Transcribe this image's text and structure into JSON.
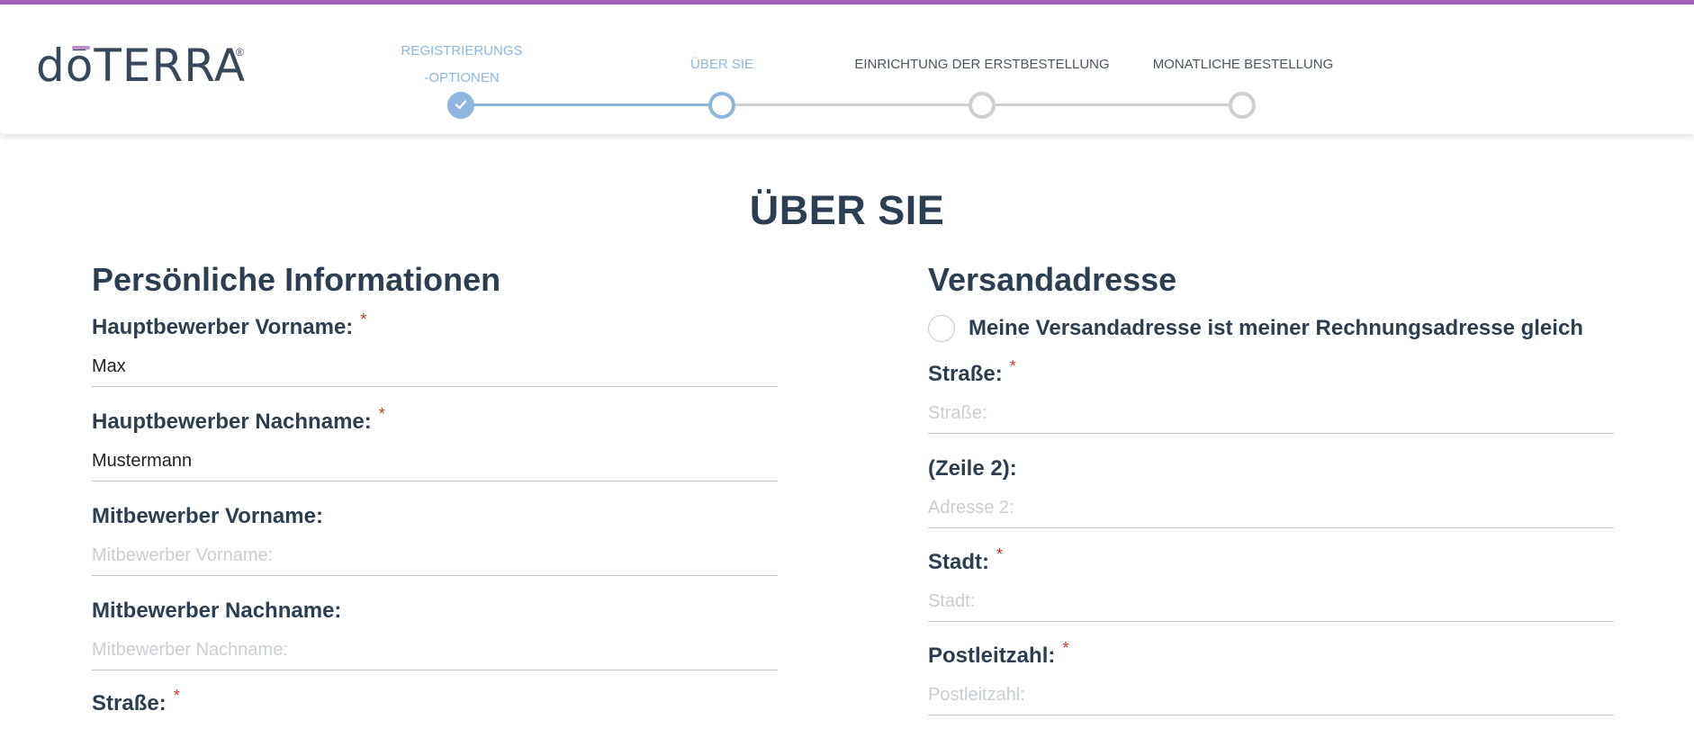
{
  "brand": {
    "logo_text": "dōTERRA",
    "registered": "®"
  },
  "steps": [
    {
      "line1": "REGISTRIERUNGS",
      "line2": "-OPTIONEN",
      "state": "done"
    },
    {
      "line1": "ÜBER SIE",
      "line2": "",
      "state": "current"
    },
    {
      "line1": "EINRICHTUNG DER ERSTBESTELLUNG",
      "line2": "",
      "state": "pending"
    },
    {
      "line1": "MONATLICHE BESTELLUNG",
      "line2": "",
      "state": "pending"
    }
  ],
  "page_title": "ÜBER SIE",
  "personal": {
    "title": "Persönliche Informationen",
    "fields": [
      {
        "label": "Hauptbewerber Vorname:",
        "required": "*",
        "value": "Max",
        "placeholder": ""
      },
      {
        "label": "Hauptbewerber Nachname:",
        "required": "*",
        "value": "Mustermann",
        "placeholder": ""
      },
      {
        "label": "Mitbewerber Vorname:",
        "required": "",
        "value": "",
        "placeholder": "Mitbewerber Vorname:"
      },
      {
        "label": "Mitbewerber Nachname:",
        "required": "",
        "value": "",
        "placeholder": "Mitbewerber Nachname:"
      },
      {
        "label": "Straße:",
        "required": "*",
        "value": "",
        "placeholder": ""
      }
    ]
  },
  "shipping": {
    "title": "Versandadresse",
    "same_as_billing_label": "Meine Versandadresse ist meiner Rechnungsadresse gleich",
    "fields": [
      {
        "label": "Straße:",
        "required": "*",
        "value": "",
        "placeholder": "Straße:"
      },
      {
        "label": "(Zeile 2):",
        "required": "",
        "value": "",
        "placeholder": "Adresse 2:"
      },
      {
        "label": "Stadt:",
        "required": "*",
        "value": "",
        "placeholder": "Stadt:"
      },
      {
        "label": "Postleitzahl:",
        "required": "*",
        "value": "",
        "placeholder": "Postleitzahl:"
      }
    ]
  },
  "colors": {
    "accent": "#8fb6de",
    "topbar": "#a35fbd",
    "heading": "#2c3e50",
    "required": "#c0392b"
  }
}
